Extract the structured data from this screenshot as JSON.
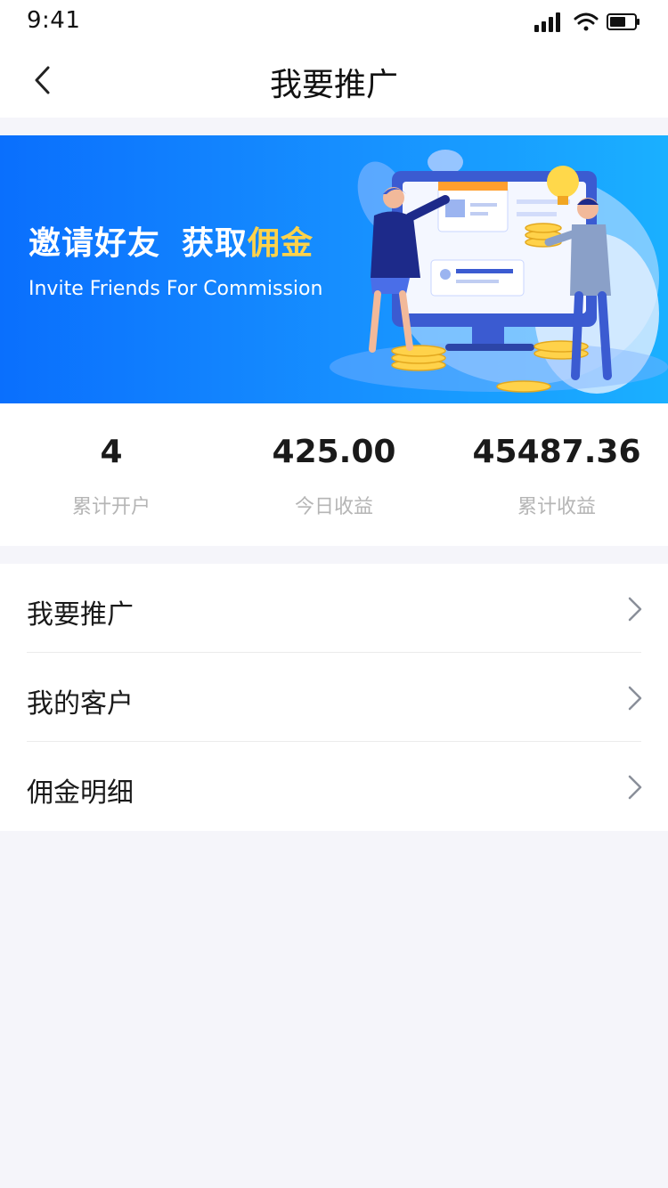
{
  "status_bar": {
    "time": "9:41"
  },
  "nav": {
    "title": "我要推广"
  },
  "banner": {
    "title_part1": "邀请好友",
    "title_part2": "获取",
    "title_highlight": "佣金",
    "subtitle": "Invite Friends For Commission",
    "illustration": "referral-illustration"
  },
  "stats": [
    {
      "value": "4",
      "label": "累计开户"
    },
    {
      "value": "425.00",
      "label": "今日收益"
    },
    {
      "value": "45487.36",
      "label": "累计收益"
    }
  ],
  "menu": [
    {
      "label": "我要推广"
    },
    {
      "label": "我的客户"
    },
    {
      "label": "佣金明细"
    }
  ],
  "colors": {
    "banner_start": "#0a6ffd",
    "banner_end": "#1ab0ff",
    "highlight": "#ffd24a",
    "page_bg": "#f5f5fa",
    "label_gray": "#b5b5b5"
  }
}
